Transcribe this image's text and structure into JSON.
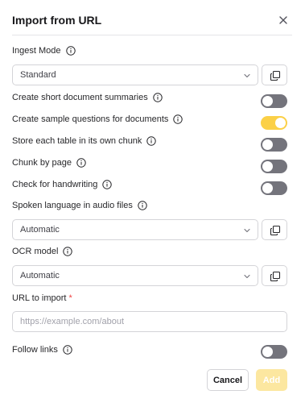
{
  "dialog": {
    "title": "Import from URL"
  },
  "fields": {
    "ingest_mode": {
      "label": "Ingest Mode",
      "value": "Standard"
    },
    "summaries": {
      "label": "Create short document summaries",
      "on": false
    },
    "sample_questions": {
      "label": "Create sample questions for documents",
      "on": true
    },
    "table_chunk": {
      "label": "Store each table in its own chunk",
      "on": false
    },
    "chunk_by_page": {
      "label": "Chunk by page",
      "on": false
    },
    "handwriting": {
      "label": "Check for handwriting",
      "on": false
    },
    "spoken_language": {
      "label": "Spoken language in audio files",
      "value": "Automatic"
    },
    "ocr_model": {
      "label": "OCR model",
      "value": "Automatic"
    },
    "url": {
      "label": "URL to import",
      "required_mark": "*",
      "placeholder": "https://example.com/about",
      "value": ""
    },
    "follow_links": {
      "label": "Follow links",
      "on": false
    }
  },
  "footer": {
    "cancel_label": "Cancel",
    "add_label": "Add"
  },
  "colors": {
    "toggle_on": "#fbd047",
    "toggle_off": "#74747c",
    "add_disabled": "#fce7a0",
    "required": "#ef4444"
  },
  "icons": {
    "close": "close-icon",
    "info": "info-icon",
    "copy": "copy-icon",
    "chevron": "chevron-down-icon"
  }
}
